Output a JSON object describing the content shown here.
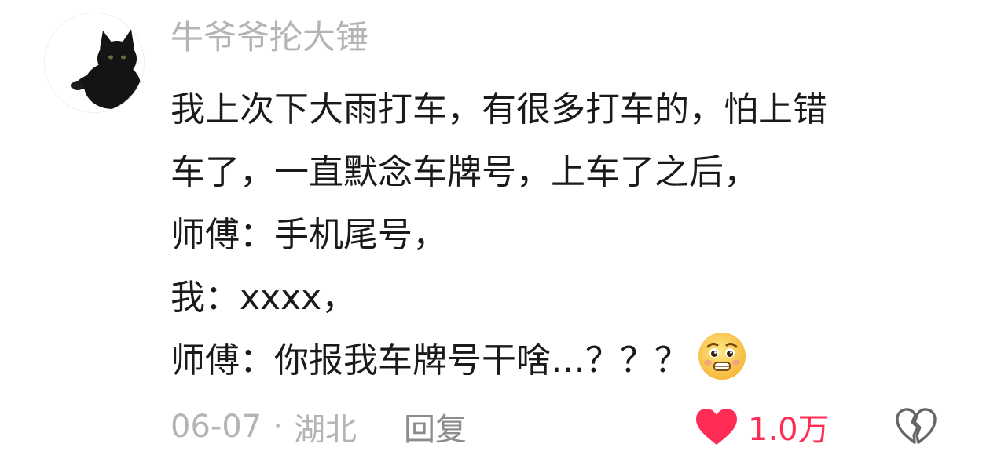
{
  "comment": {
    "username": "牛爷爷抡大锤",
    "lines": [
      "我上次下大雨打车，有很多打车的，怕上错",
      "车了，一直默念车牌号，上车了之后，",
      "师傅：手机尾号，",
      "我：xxxx，",
      "师傅：你报我车牌号干啥…？？？"
    ],
    "emoji": "pleading-anxious-face-emoji",
    "date": "06-07",
    "separator": "·",
    "location": "湖北",
    "reply_label": "回复",
    "likes": "1.0万",
    "liked": true
  },
  "icons": {
    "avatar": "black-cat-avatar",
    "like": "heart-icon",
    "dislike": "broken-heart-icon"
  },
  "colors": {
    "username": "#b4b4b4",
    "text": "#1a1a1a",
    "meta": "#b4b4b4",
    "reply": "#8c8c8c",
    "like": "#ff2d55",
    "dislike_outline": "#666666"
  }
}
